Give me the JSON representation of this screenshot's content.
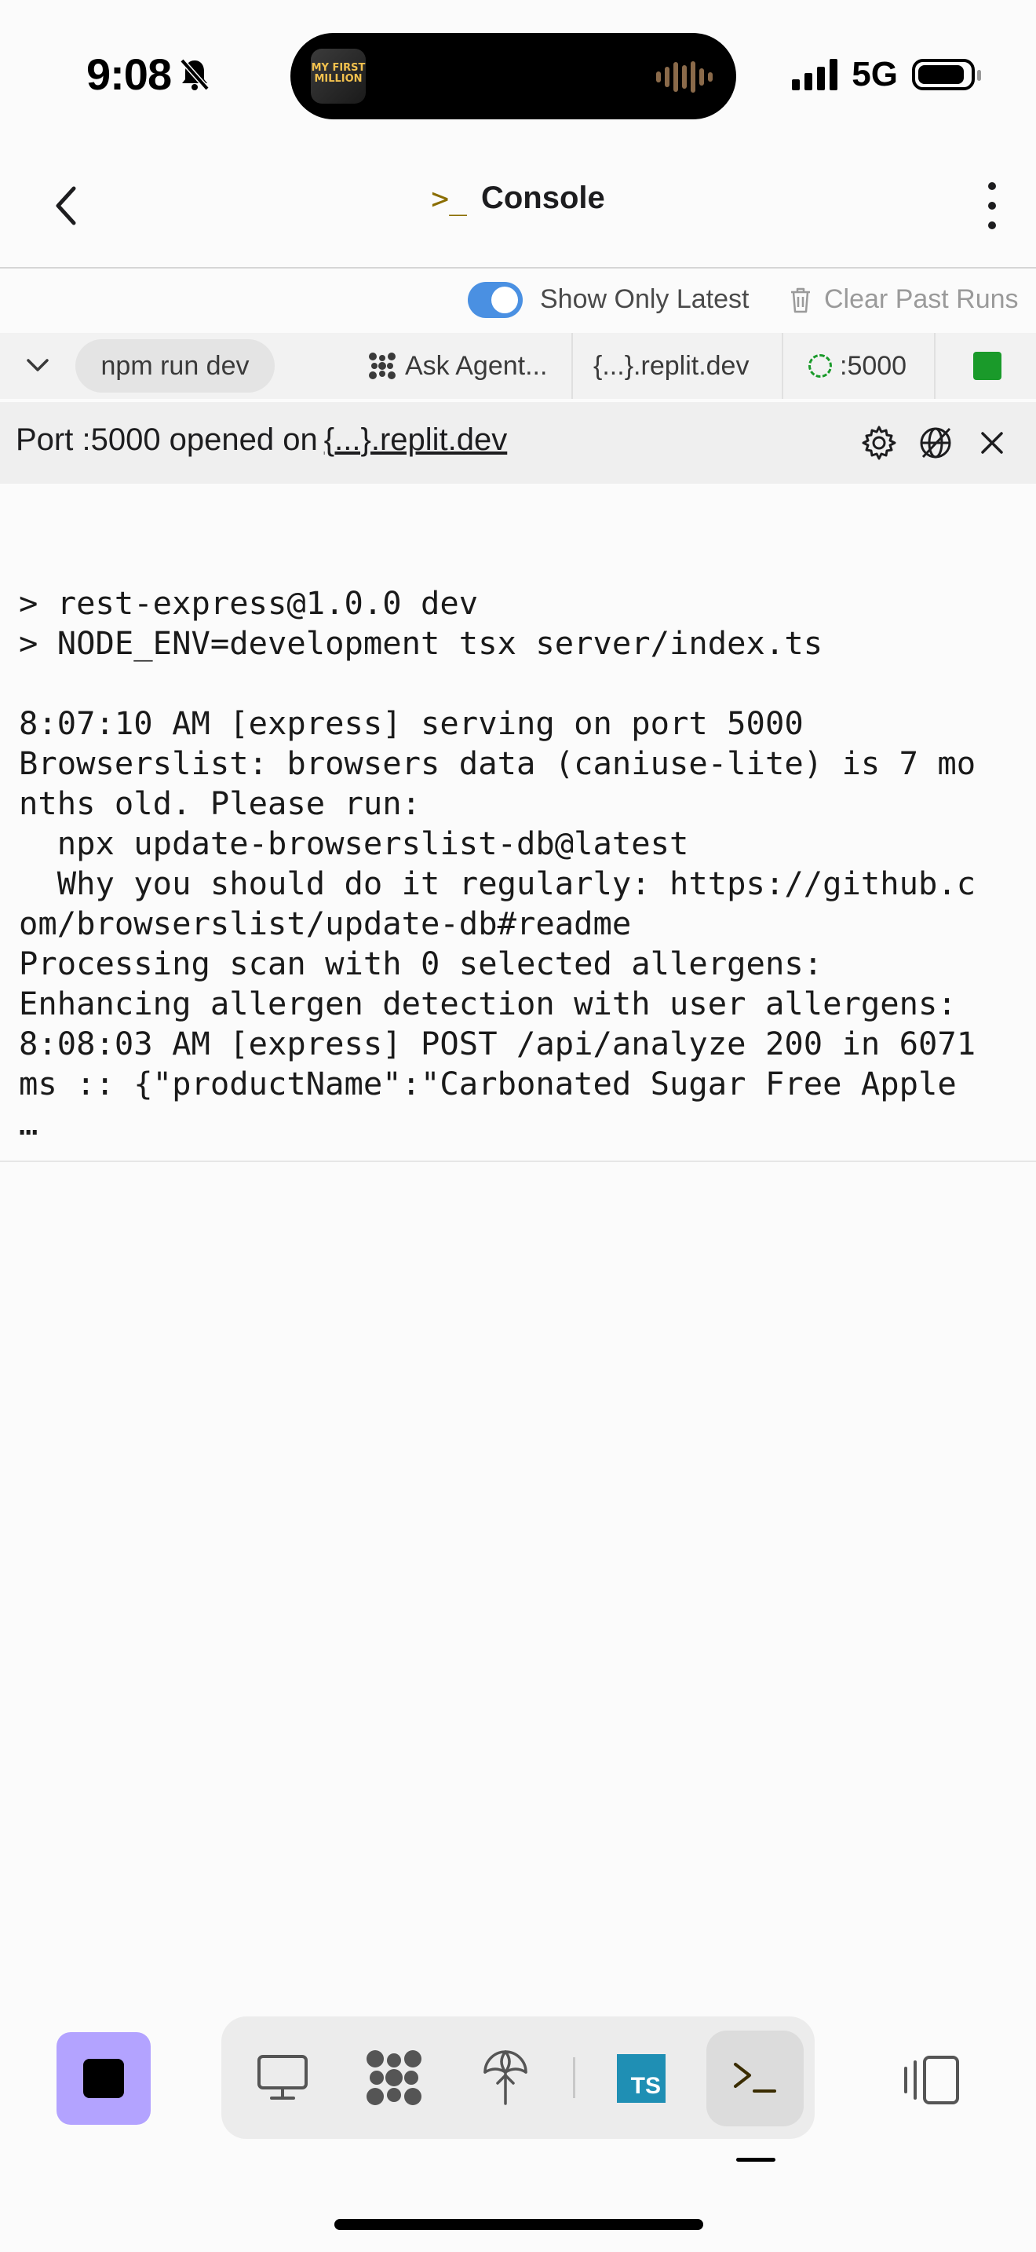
{
  "status_bar": {
    "time": "9:08",
    "network": "5G",
    "island_art_text": "MY FIRST MILLION"
  },
  "header": {
    "title": "Console",
    "title_icon": ">_"
  },
  "toolbar": {
    "show_only_latest_label": "Show Only Latest",
    "show_only_latest_on": true,
    "clear_label": "Clear Past Runs"
  },
  "run_bar": {
    "command": "npm run dev",
    "tabs": [
      {
        "label": "Ask Agent...",
        "icon": "agent-icon"
      },
      {
        "label": "{...}.replit.dev",
        "icon": ""
      },
      {
        "label": ":5000",
        "icon": "port-icon"
      }
    ],
    "status_color": "#1a9a2a"
  },
  "banner": {
    "prefix": "Port :5000 opened on",
    "link": "{...}.replit.dev"
  },
  "console": {
    "lines": [
      "",
      "> rest-express@1.0.0 dev",
      "> NODE_ENV=development tsx server/index.ts",
      "",
      "8:07:10 AM [express] serving on port 5000",
      "Browserslist: browsers data (caniuse-lite) is 7 mo",
      "nths old. Please run:",
      "  npx update-browserslist-db@latest",
      "  Why you should do it regularly: https://github.c",
      "om/browserslist/update-db#readme",
      "Processing scan with 0 selected allergens:",
      "Enhancing allergen detection with user allergens:",
      "8:08:03 AM [express] POST /api/analyze 200 in 6071",
      "ms :: {\"productName\":\"Carbonated Sugar Free Apple",
      "…"
    ]
  },
  "dock": {
    "ts_label": "TS",
    "items": [
      "preview-icon",
      "agent-icon",
      "deploy-icon",
      "typescript-icon",
      "console-icon"
    ],
    "console_label": ">_"
  },
  "colors": {
    "accent": "#4a90e2",
    "stop": "#b3a3ff",
    "ts": "#1f8fb4"
  }
}
